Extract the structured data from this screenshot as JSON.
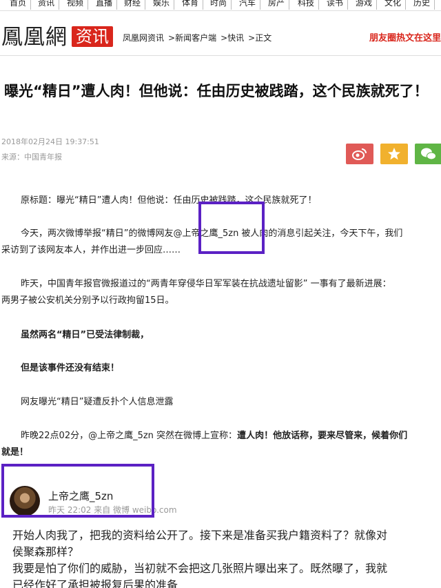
{
  "topnav": [
    "首页",
    "资讯",
    "视频",
    "直播",
    "财经",
    "娱乐",
    "体育",
    "时尚",
    "汽车",
    "房产",
    "科技",
    "读书",
    "游戏",
    "文化",
    "历史"
  ],
  "brand": {
    "logo": "鳳凰網",
    "channel": "资讯",
    "crumbs": [
      "凤凰网资讯",
      ">新闻客户端",
      ">快讯",
      ">正文"
    ],
    "promo": "朋友圈热文在这里"
  },
  "article": {
    "title": "曝光“精日”遭人肉！但他说：任由历史被践踏，这个民族就死了！",
    "date": "2018年02月24日 19:37:51",
    "source": "来源：中国青年报",
    "p1": "原标题：曝光“精日”遭人肉！但他说：任由历史被践踏，这个民族就死了！",
    "p2a": "今天，两次微博举报“精日”的微博网友@上帝之鹰_5zn 被人肉的消息引起关注，今天下午，我们",
    "p2b": "采访到了该网友本人，并作出进一步回应……",
    "p3a": "昨天，中国青年报官微报道过的“两青年穿侵华日军军装在抗战遗址留影” 一事有了最新进展：",
    "p3b": "两男子被公安机关分别予以行政拘留15日。",
    "p4": "虽然两名“精日”已受法律制裁，",
    "p5": "但是该事件还没有结束！",
    "p6": "网友曝光“精日”疑遭反扑个人信息泄露",
    "p7a_normal": "昨晚22点02分，@上帝之鹰_5zn 突然在微博上宣称：",
    "p7a_bold": "遭人肉！他放话称，要来尽管来，候着你们",
    "p7b": "就是！"
  },
  "weibo": {
    "name": "上帝之鹰_5zn",
    "time": "昨天 22:02 来自 微博 weibo.com",
    "lines": [
      "开始人肉我了，把我的资料给公开了。接下来是准备买我户籍资料了？就像对",
      "侯聚森那样？",
      "我要是怕了你们的威胁，当初就不会把这几张照片曝出来了。既然曝了，我就",
      "已经作好了承担被报复后果的准备"
    ]
  },
  "colors": {
    "accent": "#d9261c",
    "highlight": "#5b21c4",
    "weibo": "#e05a57",
    "fav": "#f1b12e",
    "wechat": "#5fb545"
  }
}
